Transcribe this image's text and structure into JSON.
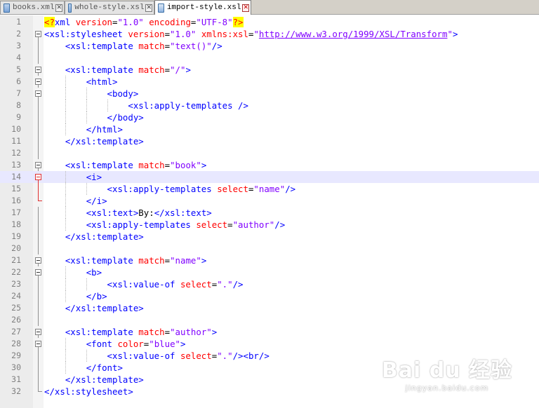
{
  "tabs": [
    {
      "label": "books.xml",
      "active": false
    },
    {
      "label": "whole-style.xsl",
      "active": false
    },
    {
      "label": "import-style.xsl",
      "active": true
    }
  ],
  "editor": {
    "current_line": 14,
    "lines": [
      [
        [
          "pi",
          "<?"
        ],
        [
          "tag",
          "xml "
        ],
        [
          "attr",
          "version"
        ],
        [
          "plain",
          "="
        ],
        [
          "val",
          "\"1.0\""
        ],
        [
          "attr",
          " encoding"
        ],
        [
          "plain",
          "="
        ],
        [
          "val",
          "\"UTF-8\""
        ],
        [
          "pi",
          "?>"
        ]
      ],
      [
        [
          "tag",
          "<xsl:stylesheet "
        ],
        [
          "attr",
          "version"
        ],
        [
          "plain",
          "="
        ],
        [
          "val",
          "\"1.0\""
        ],
        [
          "attr",
          " xmlns:xsl"
        ],
        [
          "plain",
          "="
        ],
        [
          "val",
          "\""
        ],
        [
          "url",
          "http://www.w3.org/1999/XSL/Transform"
        ],
        [
          "val",
          "\""
        ],
        [
          "tag",
          ">"
        ]
      ],
      [
        [
          "plain",
          "    "
        ],
        [
          "tag",
          "<xsl:template "
        ],
        [
          "attr",
          "match"
        ],
        [
          "plain",
          "="
        ],
        [
          "val",
          "\"text()\""
        ],
        [
          "tag",
          "/>"
        ]
      ],
      [],
      [
        [
          "plain",
          "    "
        ],
        [
          "tag",
          "<xsl:template "
        ],
        [
          "attr",
          "match"
        ],
        [
          "plain",
          "="
        ],
        [
          "val",
          "\"/\""
        ],
        [
          "tag",
          ">"
        ]
      ],
      [
        [
          "plain",
          "        "
        ],
        [
          "tag",
          "<html>"
        ]
      ],
      [
        [
          "plain",
          "            "
        ],
        [
          "tag",
          "<body>"
        ]
      ],
      [
        [
          "plain",
          "                "
        ],
        [
          "tag",
          "<xsl:apply-templates />"
        ]
      ],
      [
        [
          "plain",
          "            "
        ],
        [
          "tag",
          "</body>"
        ]
      ],
      [
        [
          "plain",
          "        "
        ],
        [
          "tag",
          "</html>"
        ]
      ],
      [
        [
          "plain",
          "    "
        ],
        [
          "tag",
          "</xsl:template>"
        ]
      ],
      [],
      [
        [
          "plain",
          "    "
        ],
        [
          "tag",
          "<xsl:template "
        ],
        [
          "attr",
          "match"
        ],
        [
          "plain",
          "="
        ],
        [
          "val",
          "\"book\""
        ],
        [
          "tag",
          ">"
        ]
      ],
      [
        [
          "plain",
          "        "
        ],
        [
          "tag",
          "<i>"
        ]
      ],
      [
        [
          "plain",
          "            "
        ],
        [
          "tag",
          "<xsl:apply-templates "
        ],
        [
          "attr",
          "select"
        ],
        [
          "plain",
          "="
        ],
        [
          "val",
          "\"name\""
        ],
        [
          "tag",
          "/>"
        ]
      ],
      [
        [
          "plain",
          "        "
        ],
        [
          "tag",
          "</i>"
        ]
      ],
      [
        [
          "plain",
          "        "
        ],
        [
          "tag",
          "<xsl:text>"
        ],
        [
          "plain",
          "By:"
        ],
        [
          "tag",
          "</xsl:text>"
        ]
      ],
      [
        [
          "plain",
          "        "
        ],
        [
          "tag",
          "<xsl:apply-templates "
        ],
        [
          "attr",
          "select"
        ],
        [
          "plain",
          "="
        ],
        [
          "val",
          "\"author\""
        ],
        [
          "tag",
          "/>"
        ]
      ],
      [
        [
          "plain",
          "    "
        ],
        [
          "tag",
          "</xsl:template>"
        ]
      ],
      [],
      [
        [
          "plain",
          "    "
        ],
        [
          "tag",
          "<xsl:template "
        ],
        [
          "attr",
          "match"
        ],
        [
          "plain",
          "="
        ],
        [
          "val",
          "\"name\""
        ],
        [
          "tag",
          ">"
        ]
      ],
      [
        [
          "plain",
          "        "
        ],
        [
          "tag",
          "<b>"
        ]
      ],
      [
        [
          "plain",
          "            "
        ],
        [
          "tag",
          "<xsl:value-of "
        ],
        [
          "attr",
          "select"
        ],
        [
          "plain",
          "="
        ],
        [
          "val",
          "\".\""
        ],
        [
          "tag",
          "/>"
        ]
      ],
      [
        [
          "plain",
          "        "
        ],
        [
          "tag",
          "</b>"
        ]
      ],
      [
        [
          "plain",
          "    "
        ],
        [
          "tag",
          "</xsl:template>"
        ]
      ],
      [],
      [
        [
          "plain",
          "    "
        ],
        [
          "tag",
          "<xsl:template "
        ],
        [
          "attr",
          "match"
        ],
        [
          "plain",
          "="
        ],
        [
          "val",
          "\"author\""
        ],
        [
          "tag",
          ">"
        ]
      ],
      [
        [
          "plain",
          "        "
        ],
        [
          "tag",
          "<font "
        ],
        [
          "attr",
          "color"
        ],
        [
          "plain",
          "="
        ],
        [
          "val",
          "\"blue\""
        ],
        [
          "tag",
          ">"
        ]
      ],
      [
        [
          "plain",
          "            "
        ],
        [
          "tag",
          "<xsl:value-of "
        ],
        [
          "attr",
          "select"
        ],
        [
          "plain",
          "="
        ],
        [
          "val",
          "\".\""
        ],
        [
          "tag",
          "/><br/>"
        ]
      ],
      [
        [
          "plain",
          "        "
        ],
        [
          "tag",
          "</font>"
        ]
      ],
      [
        [
          "plain",
          "    "
        ],
        [
          "tag",
          "</xsl:template>"
        ]
      ],
      [
        [
          "tag",
          "</xsl:stylesheet>"
        ]
      ]
    ]
  },
  "watermark": {
    "logo_text": "Bai du 经验",
    "site": "jingyan.baidu.com"
  },
  "colors": {
    "tag": "#0000ff",
    "attribute": "#ff0000",
    "value": "#8000ff",
    "highlight": "#ffff00",
    "current_line": "#e8e8ff"
  }
}
